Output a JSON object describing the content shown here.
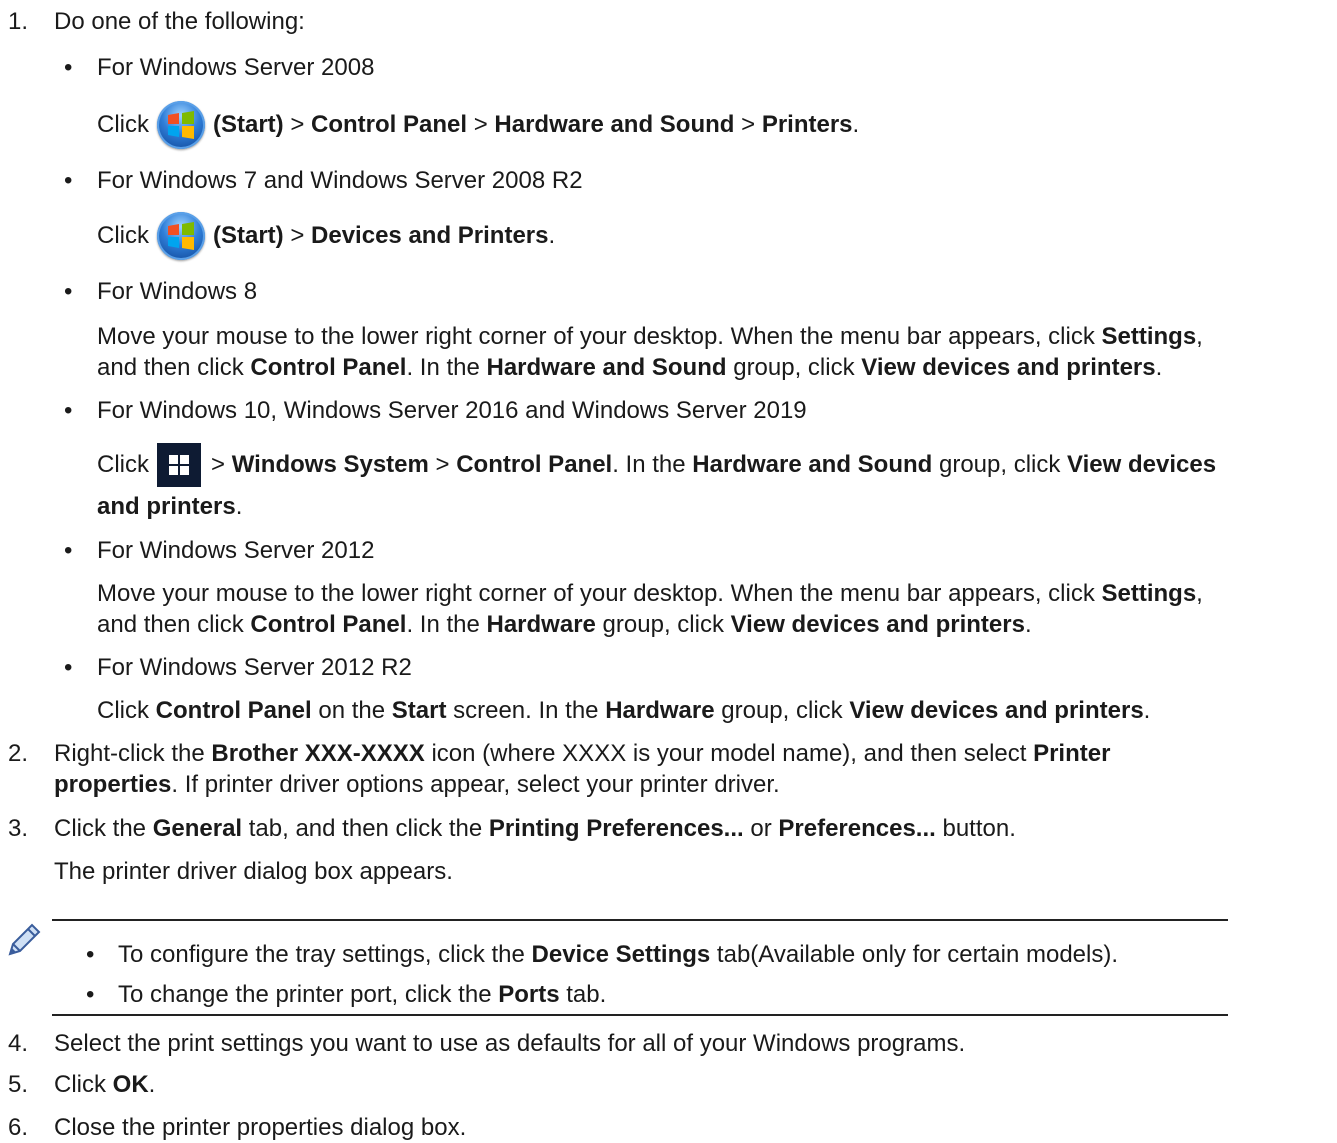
{
  "steps": {
    "s1": {
      "num": "1.",
      "text": "Do one of the following:"
    },
    "ws2008": {
      "label": "For Windows Server 2008",
      "click": "Click",
      "start": "(Start)",
      "sep": ">",
      "path1": "Control Panel",
      "path2": "Hardware and Sound",
      "path3": "Printers",
      "end": "."
    },
    "w7": {
      "label": "For Windows 7 and Windows Server 2008 R2",
      "click": "Click",
      "start": "(Start)",
      "sep": ">",
      "path1": "Devices and Printers",
      "end": "."
    },
    "w8": {
      "label": "For Windows 8",
      "t1": "Move your mouse to the lower right corner of your desktop. When the menu bar appears, click ",
      "b1": "Settings",
      "t2": ",",
      "t3": "and then click ",
      "b2": "Control Panel",
      "t4": ". In the ",
      "b3": "Hardware and Sound",
      "t5": " group, click ",
      "b4": "View devices and printers",
      "t6": "."
    },
    "w10": {
      "label": "For Windows 10, Windows Server 2016 and Windows Server 2019",
      "click": "Click",
      "sep": ">",
      "b1": "Windows System",
      "b2": "Control Panel",
      "t1": ". In the ",
      "b3": "Hardware and Sound",
      "t2": " group, click ",
      "b4": "View devices",
      "b5": "and printers",
      "t3": "."
    },
    "ws2012": {
      "label": "For Windows Server 2012",
      "t1": "Move your mouse to the lower right corner of your desktop. When the menu bar appears, click ",
      "b1": "Settings",
      "t2": ",",
      "t3": "and then click ",
      "b2": "Control Panel",
      "t4": ". In the ",
      "b3": "Hardware",
      "t5": " group, click ",
      "b4": "View devices and printers",
      "t6": "."
    },
    "ws2012r2": {
      "label": "For Windows Server 2012 R2",
      "t1": "Click ",
      "b1": "Control Panel",
      "t2": " on the ",
      "b2": "Start",
      "t3": " screen. In the ",
      "b3": "Hardware",
      "t4": " group, click ",
      "b4": "View devices and printers",
      "t5": "."
    },
    "s2": {
      "num": "2.",
      "t1": "Right-click the ",
      "b1": "Brother XXX-XXXX",
      "t2": " icon (where XXXX is your model name), and then select ",
      "b2": "Printer",
      "b3": "properties",
      "t3": ". If printer driver options appear, select your printer driver."
    },
    "s3": {
      "num": "3.",
      "t1": "Click the ",
      "b1": "General",
      "t2": " tab, and then click the ",
      "b2": "Printing Preferences...",
      "t3": " or ",
      "b3": "Preferences...",
      "t4": " button.",
      "t5": "The printer driver dialog box appears."
    },
    "note": {
      "n1a": "To configure the tray settings, click the ",
      "n1b": "Device Settings",
      "n1c": " tab(Available only for certain models).",
      "n2a": "To change the printer port, click the ",
      "n2b": "Ports",
      "n2c": " tab."
    },
    "s4": {
      "num": "4.",
      "text": "Select the print settings you want to use as defaults for all of your Windows programs."
    },
    "s5": {
      "num": "5.",
      "t1": "Click ",
      "b1": "OK",
      "t2": "."
    },
    "s6": {
      "num": "6.",
      "text": "Close the printer properties dialog box."
    }
  },
  "bullet_char": "•",
  "icons": {
    "start": "windows-start-orb-icon",
    "tile": "windows-logo-icon",
    "note": "pencil-note-icon"
  }
}
